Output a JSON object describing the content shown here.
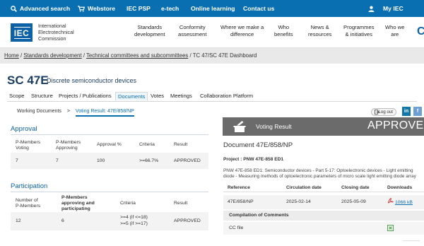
{
  "topbar": {
    "advanced_search": "Advanced search",
    "webstore": "Webstore",
    "iec_psp": "IEC PSP",
    "etech": "e-tech",
    "online_learning": "Online learning",
    "contact_us": "Contact us",
    "my_iec": "My IEC",
    "bg_color": "#0a6fb0"
  },
  "header": {
    "logo": "IEC",
    "org_line1": "International",
    "org_line2": "Electrotechnical",
    "org_line3": "Commission",
    "nav": [
      {
        "line1": "Standards",
        "line2": "development"
      },
      {
        "line1": "Conformity",
        "line2": "assessment"
      },
      {
        "line1": "Where we make a",
        "line2": "difference"
      },
      {
        "line1": "Who",
        "line2": "benefits"
      },
      {
        "line1": "News &",
        "line2": "resources"
      },
      {
        "line1": "Programmes",
        "line2": "& initiatives"
      },
      {
        "line1": "Who we",
        "line2": "are"
      }
    ]
  },
  "breadcrumb": {
    "home": "Home",
    "standards": "Standards development",
    "committees": "Technical committees and subcommittees",
    "current": "TC 47/SC 47E Dashboard",
    "sep": " / "
  },
  "title": {
    "code": "SC 47E",
    "name": "Discrete semiconductor devices"
  },
  "tabs": [
    "Scope",
    "Structure",
    "Projects / Publications",
    "Documents",
    "Votes",
    "Meetings",
    "Collaboration Platform"
  ],
  "active_tab": "Documents",
  "subnav": {
    "working": "Working Documents",
    "sep": ">",
    "current": "Voting Result: 47E/858/NP"
  },
  "approval": {
    "title": "Approval",
    "headers": {
      "pm_voting_1": "P-Members",
      "pm_voting_2": "Voting",
      "pm_approving_1": "P-Members",
      "pm_approving_2": "Approving",
      "approval_pct": "Approval %",
      "criteria": "Criteria",
      "result": "Result"
    },
    "row": {
      "voting": "7",
      "approving": "7",
      "pct": "100",
      "criteria": ">=66.7%",
      "result": "APPROVED"
    }
  },
  "participation": {
    "title": "Participation",
    "headers": {
      "num_1": "Number of",
      "num_2": "P-Members",
      "pm_1": "P-Members",
      "pm_2": "approving and",
      "pm_3": "participating",
      "criteria": "Criteria",
      "result": "Result"
    },
    "row": {
      "number": "12",
      "participating": "6",
      "criteria_1": ">=4 (if <=18)",
      "criteria_2": ">=5 (if >=17)",
      "result": "APPROVED"
    }
  },
  "account": {
    "logout": "Log out",
    "linkedin": "in",
    "facebook": "f"
  },
  "vote": {
    "label": "Voting Result",
    "status": "APPROVED",
    "banner_color": "#6b6b6b"
  },
  "document": {
    "title": "Document 47E/858/NP",
    "project": "Project : PNW 47E-858 ED1",
    "description": "PNW 47E-858 ED1: Semiconductor devices - Part 5-17: Optoelectronic devices - Light emitting diode - Measuring methods of optoelectronic parameters of micro scale light emitting diode array",
    "headers": {
      "reference": "Reference",
      "circulation": "Circulation date",
      "closing": "Closing date",
      "downloads": "Downloads"
    },
    "row": {
      "reference": "47E/858/NP",
      "circulation": "2025-02-14",
      "closing": "2025-05-09",
      "size": "1066 kB"
    },
    "compilation": "Compilation of Comments",
    "cc_file": "CC file"
  }
}
